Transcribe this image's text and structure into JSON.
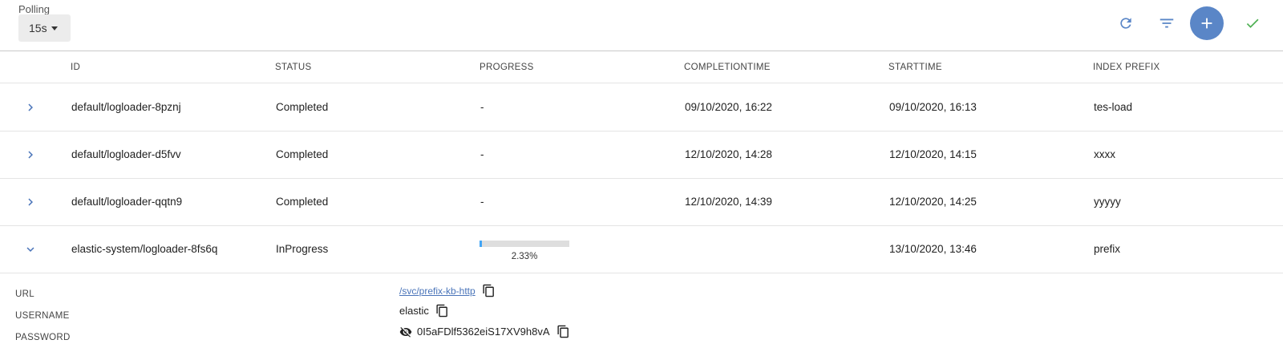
{
  "toolbar": {
    "polling_label": "Polling",
    "polling_value": "15s",
    "refresh_icon": "refresh-icon",
    "filter_icon": "filter-icon",
    "add_icon": "plus-icon",
    "check_icon": "check-icon",
    "accent_color": "#5a86c7",
    "check_color": "#4caf50"
  },
  "table": {
    "columns": [
      "ID",
      "STATUS",
      "PROGRESS",
      "COMPLETIONTIME",
      "STARTTIME",
      "INDEX PREFIX"
    ],
    "rows": [
      {
        "id": "default/logloader-8pznj",
        "status": "Completed",
        "progress": "-",
        "completion": "09/10/2020, 16:22",
        "start": "09/10/2020, 16:13",
        "prefix": "tes-load",
        "expanded": false
      },
      {
        "id": "default/logloader-d5fvv",
        "status": "Completed",
        "progress": "-",
        "completion": "12/10/2020, 14:28",
        "start": "12/10/2020, 14:15",
        "prefix": "xxxx",
        "expanded": false
      },
      {
        "id": "default/logloader-qqtn9",
        "status": "Completed",
        "progress": "-",
        "completion": "12/10/2020, 14:39",
        "start": "12/10/2020, 14:25",
        "prefix": "yyyyy",
        "expanded": false
      },
      {
        "id": "elastic-system/logloader-8fs6q",
        "status": "InProgress",
        "progress_percent": 2.33,
        "progress_text": "2.33%",
        "completion": "",
        "start": "13/10/2020, 13:46",
        "prefix": "prefix",
        "expanded": true
      }
    ]
  },
  "details": {
    "url_label": "URL",
    "url_value": "/svc/prefix-kb-http",
    "username_label": "USERNAME",
    "username_value": "elastic",
    "password_label": "PASSWORD",
    "password_value": "0I5aFDlf5362eiS17XV9h8vA",
    "copy_icon": "copy-icon",
    "visibility_icon": "visibility-off-icon"
  }
}
